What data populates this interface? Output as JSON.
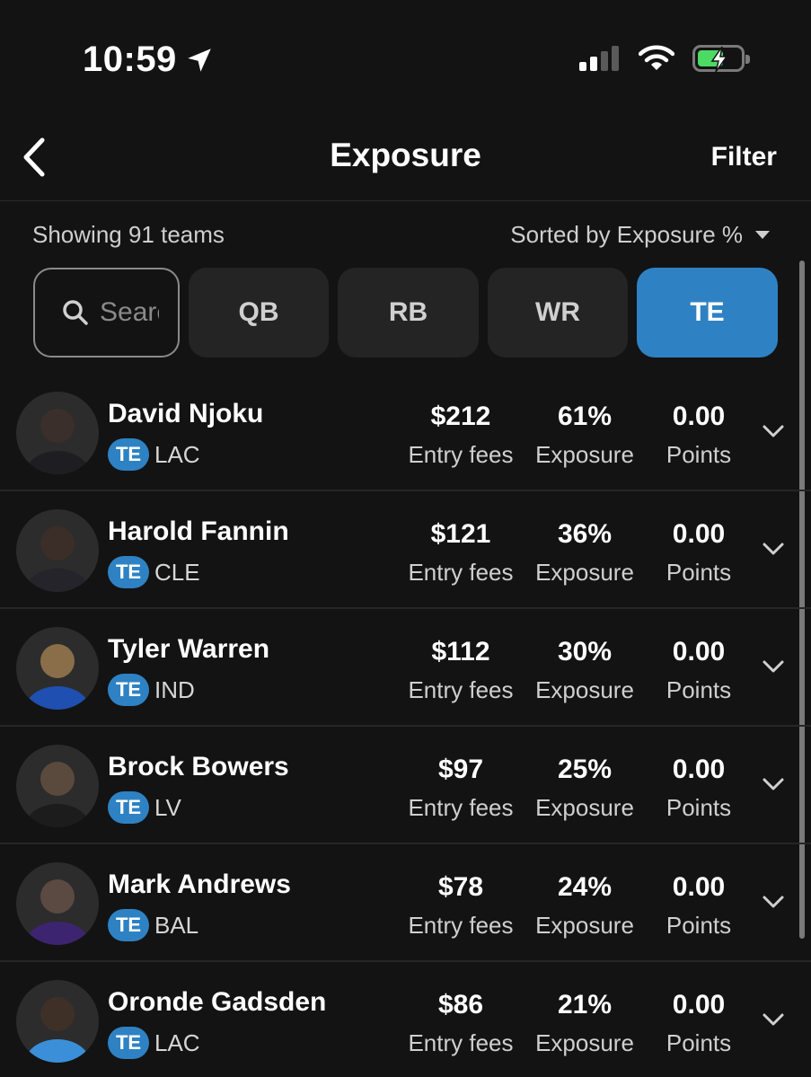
{
  "status_bar": {
    "time": "10:59"
  },
  "header": {
    "title": "Exposure",
    "filter_label": "Filter"
  },
  "summary": {
    "showing": "Showing 91 teams",
    "sort": "Sorted by Exposure %"
  },
  "search": {
    "placeholder": "Search"
  },
  "positions": [
    {
      "label": "QB",
      "active": false
    },
    {
      "label": "RB",
      "active": false
    },
    {
      "label": "WR",
      "active": false
    },
    {
      "label": "TE",
      "active": true
    }
  ],
  "labels": {
    "fees": "Entry fees",
    "exposure": "Exposure",
    "points": "Points"
  },
  "players": [
    {
      "name": "David Njoku",
      "position": "TE",
      "team": "LAC",
      "fees": "$212",
      "exposure": "61%",
      "points": "0.00",
      "avatar_color": "#3a2f2a"
    },
    {
      "name": "Harold Fannin",
      "position": "TE",
      "team": "CLE",
      "fees": "$121",
      "exposure": "36%",
      "points": "0.00",
      "avatar_color": "#3b2e28"
    },
    {
      "name": "Tyler Warren",
      "position": "TE",
      "team": "IND",
      "fees": "$112",
      "exposure": "30%",
      "points": "0.00",
      "avatar_color": "#8a6e4a"
    },
    {
      "name": "Brock Bowers",
      "position": "TE",
      "team": "LV",
      "fees": "$97",
      "exposure": "25%",
      "points": "0.00",
      "avatar_color": "#5a4a3e"
    },
    {
      "name": "Mark Andrews",
      "position": "TE",
      "team": "BAL",
      "fees": "$78",
      "exposure": "24%",
      "points": "0.00",
      "avatar_color": "#5b4a42"
    },
    {
      "name": "Oronde Gadsden",
      "position": "TE",
      "team": "LAC",
      "fees": "$86",
      "exposure": "21%",
      "points": "0.00",
      "avatar_color": "#3e2f27"
    }
  ]
}
